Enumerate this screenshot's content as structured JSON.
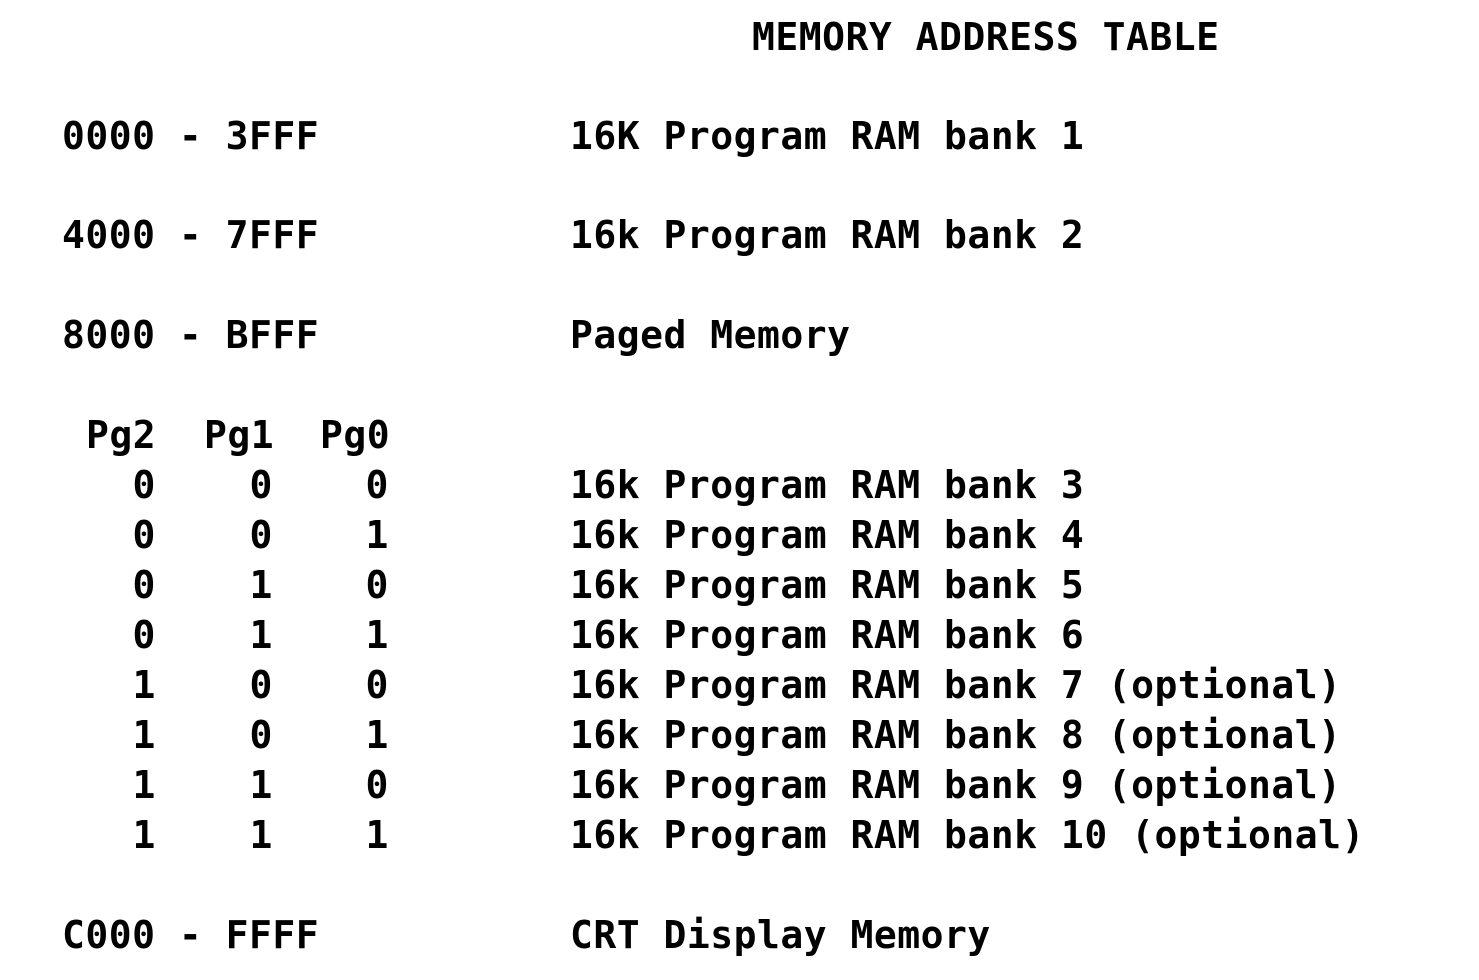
{
  "document": {
    "title": "MEMORY ADDRESS TABLE",
    "ranges": [
      {
        "range": "0000 - 3FFF",
        "description": "16K Program RAM bank 1"
      },
      {
        "range": "4000 - 7FFF",
        "description": "16k Program RAM bank 2"
      },
      {
        "range": "8000 - BFFF",
        "description": "Paged Memory"
      }
    ],
    "page_table": {
      "headers": [
        "Pg2",
        "Pg1",
        "Pg0"
      ],
      "rows": [
        {
          "bits": [
            "0",
            "0",
            "0"
          ],
          "description": "16k Program RAM bank 3"
        },
        {
          "bits": [
            "0",
            "0",
            "1"
          ],
          "description": "16k Program RAM bank 4"
        },
        {
          "bits": [
            "0",
            "1",
            "0"
          ],
          "description": "16k Program RAM bank 5"
        },
        {
          "bits": [
            "0",
            "1",
            "1"
          ],
          "description": "16k Program RAM bank 6"
        },
        {
          "bits": [
            "1",
            "0",
            "0"
          ],
          "description": "16k Program RAM bank 7 (optional)"
        },
        {
          "bits": [
            "1",
            "0",
            "1"
          ],
          "description": "16k Program RAM bank 8 (optional)"
        },
        {
          "bits": [
            "1",
            "1",
            "0"
          ],
          "description": "16k Program RAM bank 9 (optional)"
        },
        {
          "bits": [
            "1",
            "1",
            "1"
          ],
          "description": "16k Program RAM bank 10 (optional)"
        }
      ]
    },
    "final_range": {
      "range": "C000 - FFFF",
      "description": "CRT Display Memory"
    }
  }
}
